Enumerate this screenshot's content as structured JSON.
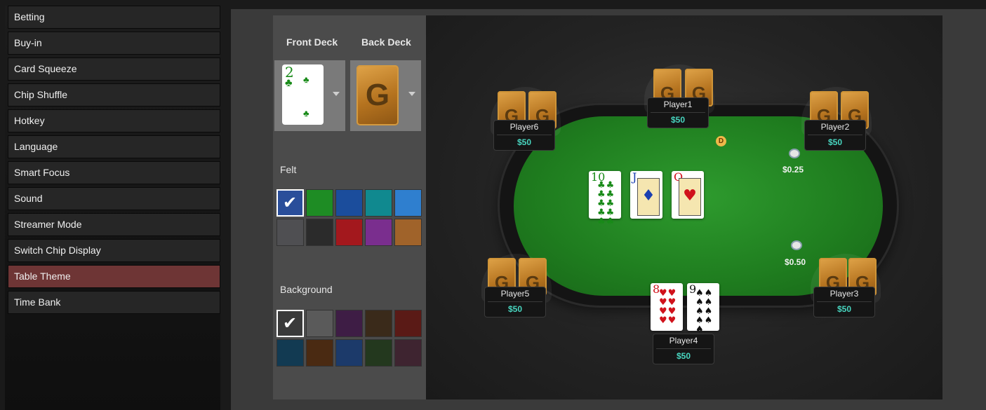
{
  "sidebar": {
    "items": [
      {
        "label": "Betting",
        "active": false
      },
      {
        "label": "Buy-in",
        "active": false
      },
      {
        "label": "Card Squeeze",
        "active": false
      },
      {
        "label": "Chip Shuffle",
        "active": false
      },
      {
        "label": "Hotkey",
        "active": false
      },
      {
        "label": "Language",
        "active": false
      },
      {
        "label": "Smart Focus",
        "active": false
      },
      {
        "label": "Sound",
        "active": false
      },
      {
        "label": "Streamer Mode",
        "active": false
      },
      {
        "label": "Switch Chip Display",
        "active": false
      },
      {
        "label": "Table Theme",
        "active": true
      },
      {
        "label": "Time Bank",
        "active": false
      }
    ],
    "active_color": "#6e3535"
  },
  "settings": {
    "front_deck_label": "Front Deck",
    "back_deck_label": "Back Deck",
    "front_deck_card": {
      "rank": "2",
      "suit": "♣"
    },
    "back_deck_logo": "G",
    "felt_label": "Felt",
    "felt_colors": [
      "#2a4e9a",
      "#1e8c24",
      "#1b4d9c",
      "#10898f",
      "#2f7fcf",
      "#4f4f52",
      "#2b2b2b",
      "#a3181d",
      "#7a2e8e",
      "#a0632a"
    ],
    "felt_selected": 0,
    "background_label": "Background",
    "background_colors": [
      "#3a3a3a",
      "#5a5a5a",
      "#3e1d45",
      "#3a2a1a",
      "#5a1a16",
      "#123a52",
      "#4a2a12",
      "#1c3a6a",
      "#23381e",
      "#3e2430"
    ],
    "background_selected": 0
  },
  "table": {
    "players": [
      {
        "name": "Player1",
        "stack": "$50"
      },
      {
        "name": "Player2",
        "stack": "$50"
      },
      {
        "name": "Player3",
        "stack": "$50"
      },
      {
        "name": "Player4",
        "stack": "$50"
      },
      {
        "name": "Player5",
        "stack": "$50"
      },
      {
        "name": "Player6",
        "stack": "$50"
      }
    ],
    "dealer_button": "D",
    "card_back_logo": "G",
    "bets": [
      {
        "amount": "$0.25"
      },
      {
        "amount": "$0.50"
      }
    ],
    "board": [
      {
        "rank": "10",
        "suit": "♣",
        "pips": "♣♣♣♣♣♣♣♣♣♣"
      },
      {
        "rank": "J",
        "suit": "♦",
        "face": "♦"
      },
      {
        "rank": "Q",
        "suit": "♥",
        "face": "♥"
      }
    ],
    "hero_cards": [
      {
        "rank": "8",
        "suit": "♥",
        "pips": "♥♥♥♥♥♥♥♥"
      },
      {
        "rank": "9",
        "suit": "♠",
        "pips": "♠♠♠♠♠♠♠♠♠"
      }
    ]
  }
}
